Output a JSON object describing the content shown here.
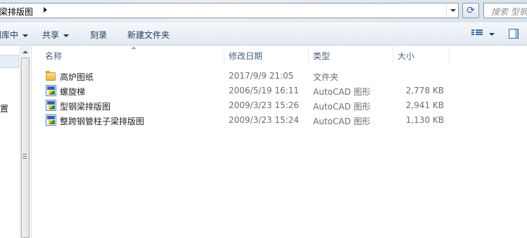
{
  "address": {
    "path": "钢梁排版图",
    "search_placeholder": "搜索 型钢"
  },
  "toolbar": {
    "include_label": "含到库中",
    "share_label": "共享",
    "burn_label": "刻录",
    "new_folder_label": "新建文件夹"
  },
  "nav": {
    "item_text": "置"
  },
  "columns": {
    "name": "名称",
    "modified": "修改日期",
    "type": "类型",
    "size": "大小"
  },
  "files": [
    {
      "name": "高炉图纸",
      "modified": "2017/9/9 21:05",
      "type": "文件夹",
      "size": "",
      "icon": "folder-icon"
    },
    {
      "name": "螺旋梯",
      "modified": "2006/5/19 16:11",
      "type": "AutoCAD 图形",
      "size": "2,778 KB",
      "icon": "autocad-file-icon"
    },
    {
      "name": "型钢梁排版图",
      "modified": "2009/3/23 15:26",
      "type": "AutoCAD 图形",
      "size": "2,941 KB",
      "icon": "autocad-file-icon"
    },
    {
      "name": "整跨钢管柱子梁排版图",
      "modified": "2009/3/23 15:24",
      "type": "AutoCAD 图形",
      "size": "1,130 KB",
      "icon": "autocad-file-icon"
    }
  ]
}
